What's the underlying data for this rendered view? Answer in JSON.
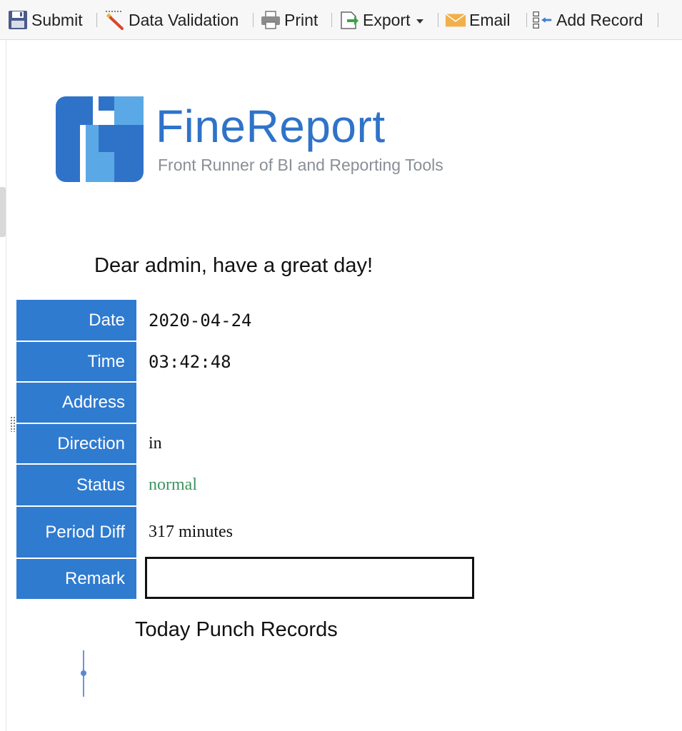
{
  "toolbar": {
    "items": [
      {
        "label": "Submit",
        "icon": "save-icon"
      },
      {
        "label": "Data Validation",
        "icon": "validation-wand-icon"
      },
      {
        "label": "Print",
        "icon": "printer-icon"
      },
      {
        "label": "Export",
        "icon": "export-icon"
      },
      {
        "label": "Email",
        "icon": "envelope-icon"
      },
      {
        "label": "Add Record",
        "icon": "add-record-icon"
      }
    ]
  },
  "logo": {
    "name": "FineReport",
    "tagline": "Front Runner of BI and Reporting Tools",
    "brand_color": "#2f73c9"
  },
  "greeting": "Dear admin, have a great day!",
  "form": {
    "rows": [
      {
        "label": "Date",
        "value": "2020-04-24"
      },
      {
        "label": "Time",
        "value": "03:42:48"
      },
      {
        "label": "Address",
        "value": ""
      },
      {
        "label": "Direction",
        "value": "in"
      },
      {
        "label": "Status",
        "value": "normal"
      },
      {
        "label": "Period Diff",
        "value": "317 minutes"
      },
      {
        "label": "Remark",
        "value": ""
      }
    ],
    "label_bg_color": "#2f7bd0",
    "status_color": "#3c9560"
  },
  "records": {
    "title": "Today Punch Records"
  }
}
